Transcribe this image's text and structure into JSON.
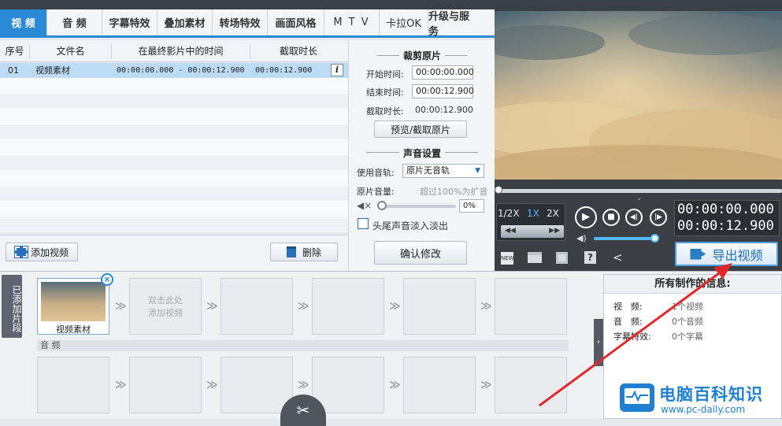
{
  "tabs": [
    {
      "label": "视 频",
      "active": true
    },
    {
      "label": "音 频"
    },
    {
      "label": "字幕特效"
    },
    {
      "label": "叠加素材"
    },
    {
      "label": "转场特效"
    },
    {
      "label": "画面风格"
    },
    {
      "label": "M T V"
    },
    {
      "label": "卡拉OK"
    },
    {
      "label": "升级与服务"
    }
  ],
  "table": {
    "headers": [
      "序号",
      "文件名",
      "在最终影片中的时间",
      "截取时长"
    ],
    "rows": [
      {
        "index": "01",
        "name": "视频素材",
        "time": "00:00:00.000 - 00:00:12.900",
        "duration": "00:00:12.900"
      }
    ]
  },
  "bottom": {
    "add_label": "添加视频",
    "delete_label": "删除"
  },
  "trim": {
    "title": "裁剪原片",
    "start_label": "开始时间:",
    "start_value": "00:00:00.000",
    "end_label": "结束时间:",
    "end_value": "00:00:12.900",
    "dur_label": "截取时长:",
    "dur_value": "00:00:12.900",
    "preview_button": "预览/截取原片"
  },
  "sound": {
    "title": "声音设置",
    "track_label": "使用音轨:",
    "track_value": "原片无音轨",
    "volume_label": "原片音量:",
    "volume_hint": "超过100%为扩音",
    "volume_value": "0%",
    "fade_label": "头尾声音淡入淡出",
    "confirm_button": "确认修改"
  },
  "player": {
    "speeds": [
      "1/2X",
      "1X",
      "2X"
    ],
    "current_time": "00:00:00.000",
    "total_time": "00:00:12.900",
    "export_label": "导出视频"
  },
  "timeline": {
    "side_label": "已添加片段",
    "clip_label": "视频素材",
    "placeholder": "双击此处\n添加视频",
    "audio_label": "音 频"
  },
  "info": {
    "title": "所有制作的信息:",
    "lines": [
      {
        "k": "视　频:",
        "v": "1个视频"
      },
      {
        "k": "音　频:",
        "v": "0个音频"
      },
      {
        "k": "字幕特效:",
        "v": "0个字幕"
      }
    ]
  },
  "watermark": {
    "title": "电脑百科知识",
    "url": "www.pc-daily.com"
  },
  "colors": {
    "accent": "#2a8ad8",
    "selection": "#bcdcf5",
    "dark": "#3b3f45",
    "timecode": "#ffffff"
  }
}
